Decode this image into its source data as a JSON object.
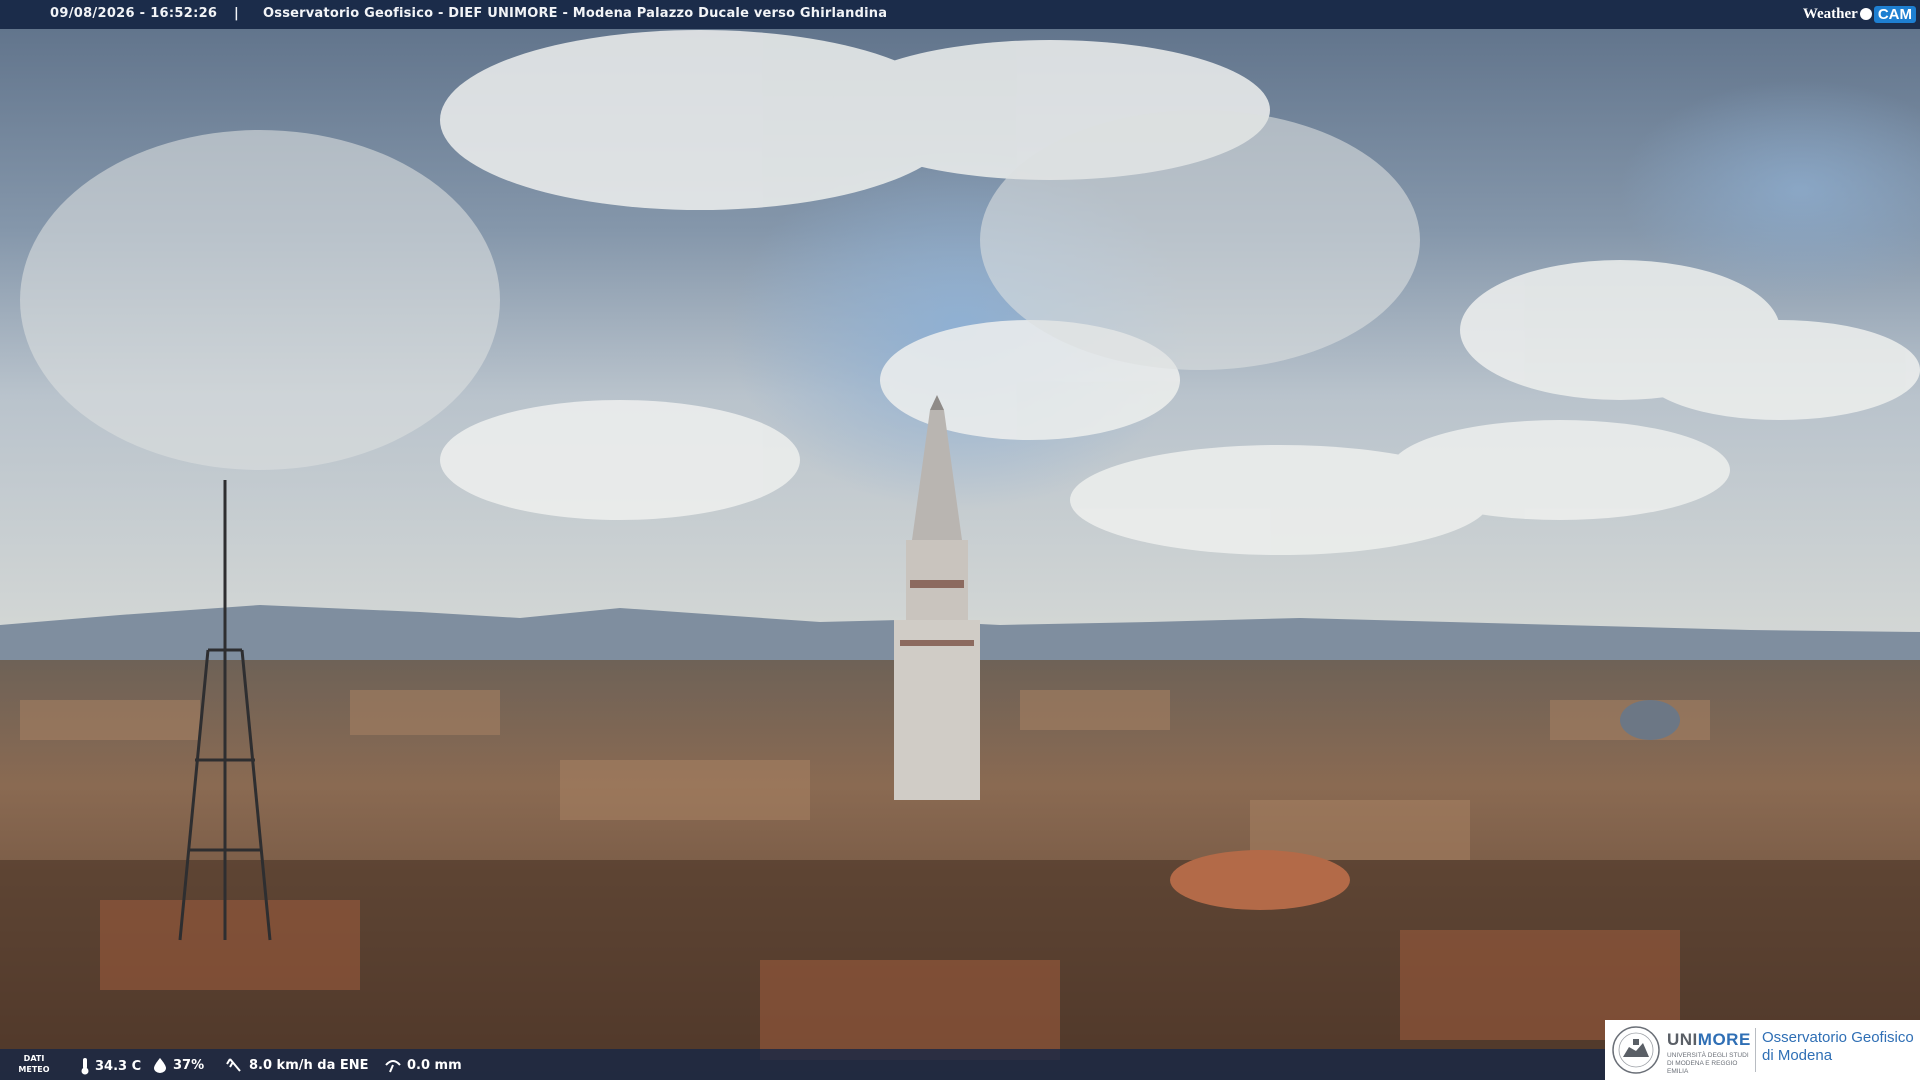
{
  "header": {
    "datetime": "09/08/2026 - 16:52:26",
    "separator": "|",
    "title": "Osservatorio Geofisico - DIEF UNIMORE - Modena Palazzo Ducale verso Ghirlandina",
    "brand_weather": "Weather",
    "brand_cam": "CAM"
  },
  "weather": {
    "label": "DATI METEO",
    "temperature": "34.3 C",
    "humidity": "37%",
    "wind": "8.0 km/h da ENE",
    "rain": "0.0 mm",
    "icons": [
      "thermometer-icon",
      "humidity-drop-icon",
      "wind-icon",
      "rain-gauge-icon"
    ]
  },
  "logo": {
    "uni_part1": "UNI",
    "uni_part2": "MORE",
    "uni_sub": "UNIVERSITÀ DEGLI STUDI DI MODENA E REGGIO EMILIA",
    "observatory": "Osservatorio Geofisico di Modena"
  },
  "colors": {
    "header_bg": "#1b2c4a",
    "accent_blue": "#2f6fb5",
    "brand_cam": "#1e7fd1"
  }
}
